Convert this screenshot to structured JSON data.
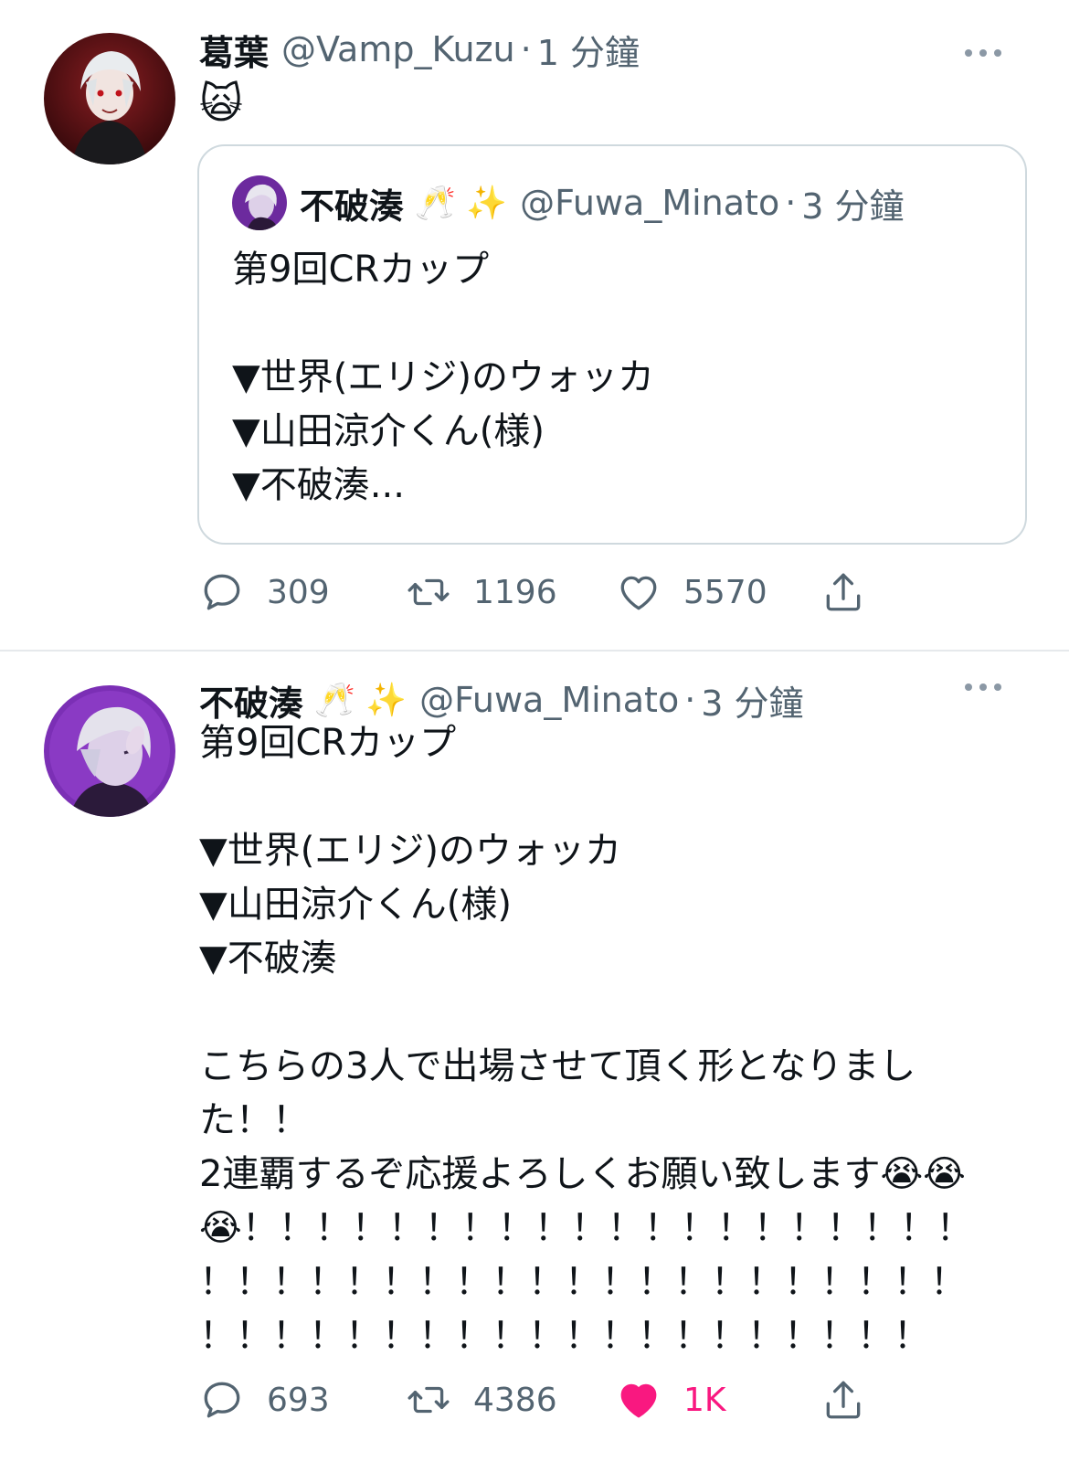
{
  "tweets": [
    {
      "display_name": "葛葉",
      "handle": "@Vamp_Kuzu",
      "separator": "·",
      "time": "1 分鐘",
      "reaction_emoji": "🙀",
      "quote": {
        "display_name": "不破湊",
        "name_emojis": "🥂 ✨",
        "handle": "@Fuwa_Minato",
        "separator": "·",
        "time": "3 分鐘",
        "text": "第9回CRカップ\n\n▼世界(エリジ)のウォッカ\n▼山田涼介くん(様)\n▼不破湊..."
      },
      "stats": {
        "replies": "309",
        "retweets": "1196",
        "likes": "5570"
      },
      "liked": false
    },
    {
      "display_name": "不破湊",
      "name_emojis": "🥂 ✨",
      "handle": "@Fuwa_Minato",
      "separator": "·",
      "time": "3 分鐘",
      "text": "第9回CRカップ\n\n▼世界(エリジ)のウォッカ\n▼山田涼介くん(様)\n▼不破湊\n\nこちらの3人で出場させて頂く形となりまし\nた！！\n2連覇するぞ応援よろしくお願い致します😭😭\n😭！！！！！！！！！！！！！！！！！！！！\n！！！！！！！！！！！！！！！！！！！！！\n！！！！！！！！！！！！！！！！！！！！",
      "stats": {
        "replies": "693",
        "retweets": "4386",
        "likes": "1K"
      },
      "liked": true
    }
  ],
  "icons": [
    "more-icon",
    "reply-icon",
    "retweet-icon",
    "like-icon",
    "share-icon"
  ],
  "colors": {
    "text": "#0f1419",
    "secondary": "#536471",
    "like": "#f91880",
    "border": "#cfd9de"
  }
}
